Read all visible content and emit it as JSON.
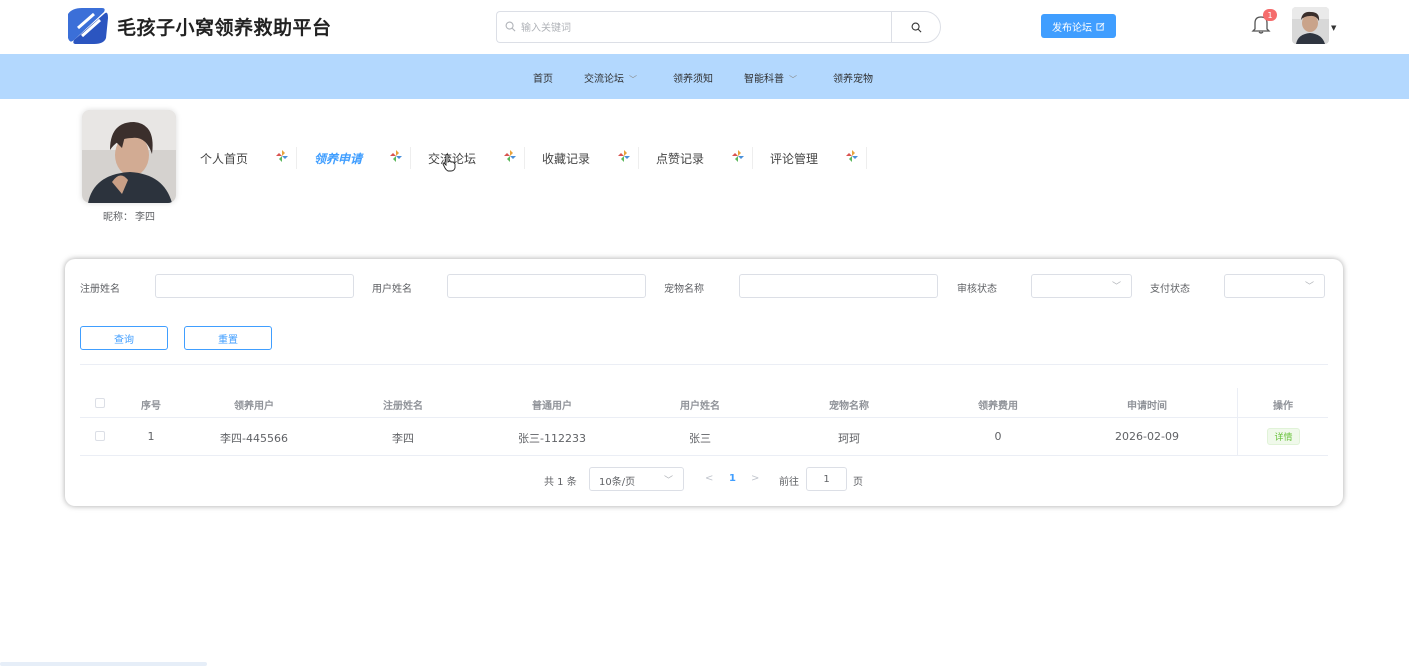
{
  "header": {
    "site_title": "毛孩子小窝领养救助平台",
    "search_placeholder": "输入关键词",
    "publish_label": "发布论坛",
    "notification_count": "1",
    "accent": "#409eff"
  },
  "nav": {
    "items": [
      {
        "label": "首页",
        "has_dropdown": false
      },
      {
        "label": "交流论坛",
        "has_dropdown": true
      },
      {
        "label": "领养须知",
        "has_dropdown": false
      },
      {
        "label": "智能科普",
        "has_dropdown": true
      },
      {
        "label": "领养宠物",
        "has_dropdown": false
      }
    ],
    "background": "#b3d8fe"
  },
  "profile": {
    "nickname_label": "昵称：",
    "nickname": "李四",
    "tabs": [
      {
        "label": "个人首页",
        "active": false
      },
      {
        "label": "领养申请",
        "active": true
      },
      {
        "label": "交流论坛",
        "active": false
      },
      {
        "label": "收藏记录",
        "active": false
      },
      {
        "label": "点赞记录",
        "active": false
      },
      {
        "label": "评论管理",
        "active": false
      }
    ]
  },
  "filters": {
    "fields": [
      {
        "label": "注册姓名",
        "value": ""
      },
      {
        "label": "用户姓名",
        "value": ""
      },
      {
        "label": "宠物名称",
        "value": ""
      },
      {
        "label": "审核状态",
        "value": "",
        "type": "select"
      },
      {
        "label": "支付状态",
        "value": "",
        "type": "select"
      }
    ],
    "query_label": "查询",
    "reset_label": "重置"
  },
  "table": {
    "columns": [
      "序号",
      "领养用户",
      "注册姓名",
      "普通用户",
      "用户姓名",
      "宠物名称",
      "领养费用",
      "申请时间",
      "操作"
    ],
    "rows": [
      {
        "index": "1",
        "adopter": "李四-445566",
        "reg_name": "李四",
        "user": "张三-112233",
        "user_name": "张三",
        "pet": "珂珂",
        "fee": "0",
        "date": "2026-02-09",
        "action": "详情"
      }
    ]
  },
  "pagination": {
    "total": "共 1 条",
    "page_size": "10条/页",
    "prev": "<",
    "current": "1",
    "next": ">",
    "goto_label": "前往",
    "goto_value": "1",
    "page_suffix": "页"
  }
}
